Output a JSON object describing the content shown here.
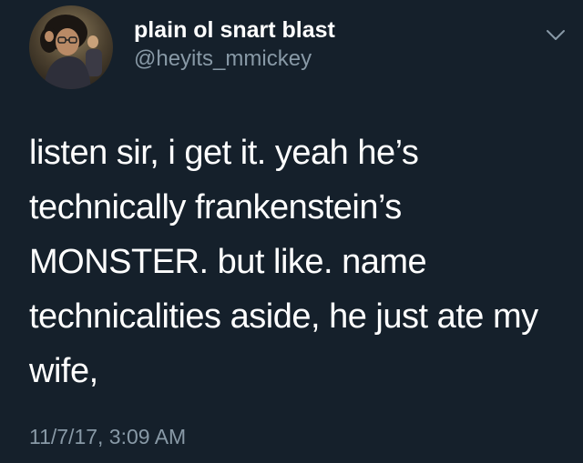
{
  "tweet": {
    "user": {
      "display_name": "plain ol snart blast",
      "handle": "@heyits_mmickey"
    },
    "body_lines": [
      "listen sir, i get it. yeah he’s",
      "technically frankenstein’s",
      "MONSTER. but like. name",
      "technicalities aside, he just ate my",
      "wife,"
    ],
    "timestamp": "11/7/17, 3:09 AM"
  },
  "icons": {
    "menu": "chevron-down-icon",
    "avatar": "profile-photo"
  },
  "colors": {
    "background": "#15202b",
    "text_primary": "#ffffff",
    "text_secondary": "#8899a6"
  }
}
